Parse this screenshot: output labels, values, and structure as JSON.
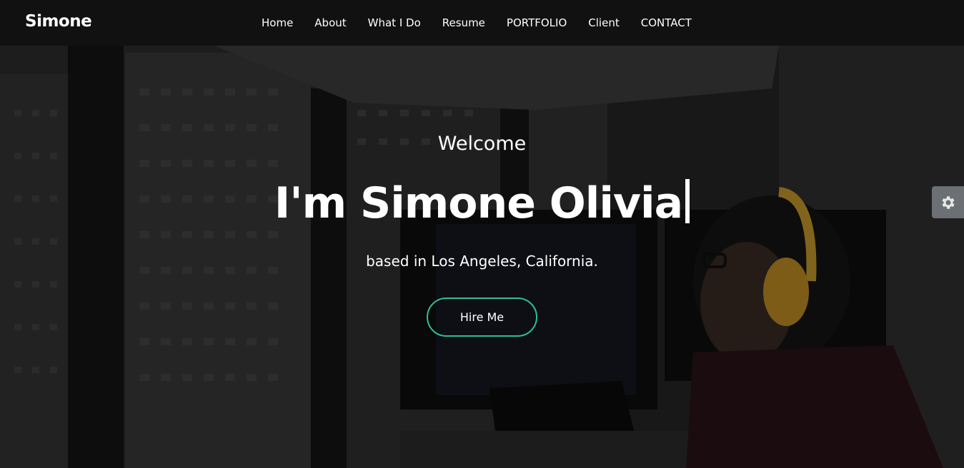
{
  "navbar": {
    "brand": "Simone",
    "links": [
      "Home",
      "About",
      "What I Do",
      "Resume",
      "PORTFOLIO",
      "Client",
      "CONTACT"
    ]
  },
  "hero": {
    "welcome": "Welcome",
    "headline": "I'm Simone Olivia",
    "subtitle": "based in Los Angeles, California.",
    "cta_label": "Hire Me"
  },
  "settings": {
    "icon": "gear-icon"
  },
  "colors": {
    "navbar_bg": "#111111",
    "accent": "#2fbf8f",
    "settings_bg": "#6c6f73",
    "text": "#ffffff"
  }
}
